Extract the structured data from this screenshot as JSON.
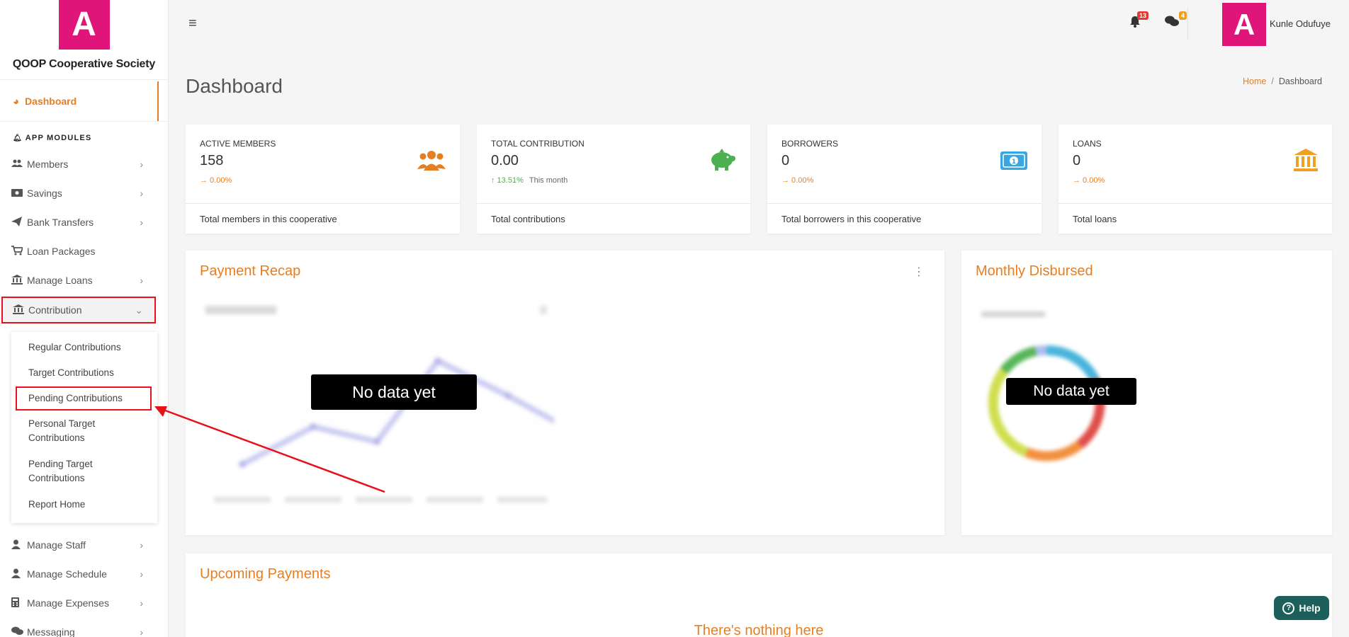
{
  "brand": {
    "logo_letter": "A",
    "name": "QOOP Cooperative Society",
    "logo_color": "#e0157a"
  },
  "sidebar": {
    "dashboard_label": "Dashboard",
    "section_title": "APP MODULES",
    "items": [
      {
        "label": "Members",
        "icon": "users-icon"
      },
      {
        "label": "Savings",
        "icon": "money-icon"
      },
      {
        "label": "Bank Transfers",
        "icon": "paper-plane-icon"
      },
      {
        "label": "Loan Packages",
        "icon": "cart-icon"
      },
      {
        "label": "Manage Loans",
        "icon": "bank-icon"
      },
      {
        "label": "Contribution",
        "icon": "bank-icon"
      },
      {
        "label": "Manage Staff",
        "icon": "user-icon"
      },
      {
        "label": "Manage Schedule",
        "icon": "user-icon"
      },
      {
        "label": "Manage Expenses",
        "icon": "calculator-icon"
      },
      {
        "label": "Messaging",
        "icon": "comments-icon"
      }
    ],
    "contribution_submenu": [
      "Regular Contributions",
      "Target Contributions",
      "Pending Contributions",
      "Personal Target Contributions",
      "Pending Target Contributions",
      "Report Home"
    ]
  },
  "topbar": {
    "notification_count": "13",
    "message_count": "4",
    "avatar_letter": "A",
    "username": "Kunle Odufuye"
  },
  "page": {
    "title": "Dashboard",
    "breadcrumb": {
      "home": "Home",
      "sep": "/",
      "current": "Dashboard"
    }
  },
  "stats": [
    {
      "label": "ACTIVE MEMBERS",
      "value": "158",
      "trend": "→ 0.00%",
      "extra": "",
      "footer": "Total members in this cooperative",
      "icon": "users-icon",
      "color": "#e67e22"
    },
    {
      "label": "TOTAL CONTRIBUTION",
      "value": "0.00",
      "trend": "↑ 13.51%",
      "extra": "This month",
      "footer": "Total contributions",
      "icon": "piggy-bank-icon",
      "color": "#4caf50"
    },
    {
      "label": "BORROWERS",
      "value": "0",
      "trend": "→ 0.00%",
      "extra": "",
      "footer": "Total borrowers in this cooperative",
      "icon": "money-bill-icon",
      "color": "#3aa6e0"
    },
    {
      "label": "LOANS",
      "value": "0",
      "trend": "→ 0.00%",
      "extra": "",
      "footer": "Total loans",
      "icon": "bank-icon",
      "color": "#f0a020"
    }
  ],
  "panels": {
    "payment_recap": {
      "title": "Payment Recap",
      "no_data": "No data yet"
    },
    "monthly_disbursed": {
      "title": "Monthly Disbursed",
      "no_data": "No data yet"
    },
    "upcoming_payments": {
      "title": "Upcoming Payments",
      "empty": "There's nothing here"
    }
  },
  "help": {
    "label": "Help"
  },
  "colors": {
    "accent": "#e67e22",
    "highlight": "#e8111b",
    "help_bg": "#1d5f5b"
  }
}
